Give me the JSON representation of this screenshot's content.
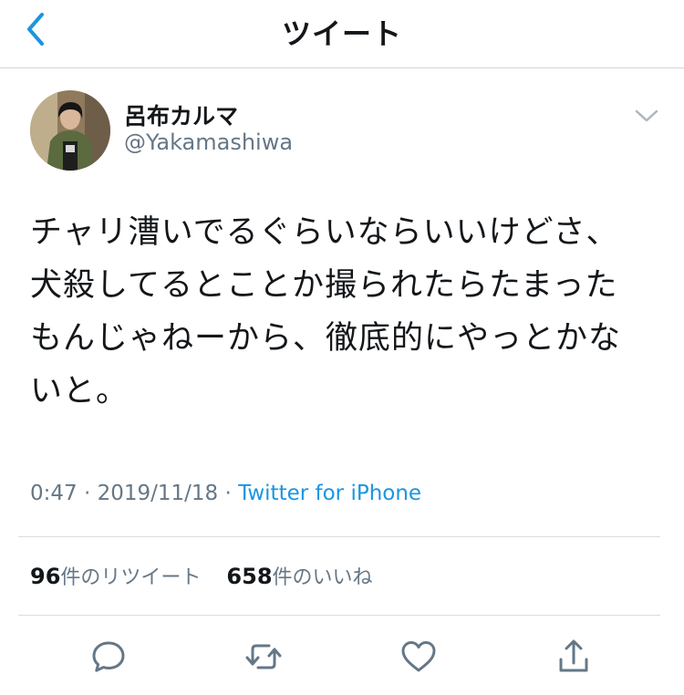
{
  "header": {
    "title": "ツイート",
    "back_icon": "chevron-left-icon"
  },
  "tweet": {
    "author": {
      "name": "呂布カルマ",
      "handle": "@Yakamashiwa"
    },
    "text": "チャリ漕いでるぐらいならいいけどさ、\n犬殺してるとことか撮られたらたまった\nもんじゃねーから、徹底的にやっとかな\nいと。",
    "time": "0:47",
    "date": "2019/11/18",
    "separator": "·",
    "source": "Twitter for iPhone"
  },
  "stats": {
    "retweets_count": "96",
    "retweets_label": "件のリツイート",
    "likes_count": "658",
    "likes_label": "件のいいね"
  },
  "actions": [
    {
      "icon": "reply-icon"
    },
    {
      "icon": "retweet-icon"
    },
    {
      "icon": "heart-icon"
    },
    {
      "icon": "share-icon"
    }
  ],
  "colors": {
    "link": "#1b95e0",
    "secondary_text": "#657786",
    "primary_text": "#14171a"
  }
}
